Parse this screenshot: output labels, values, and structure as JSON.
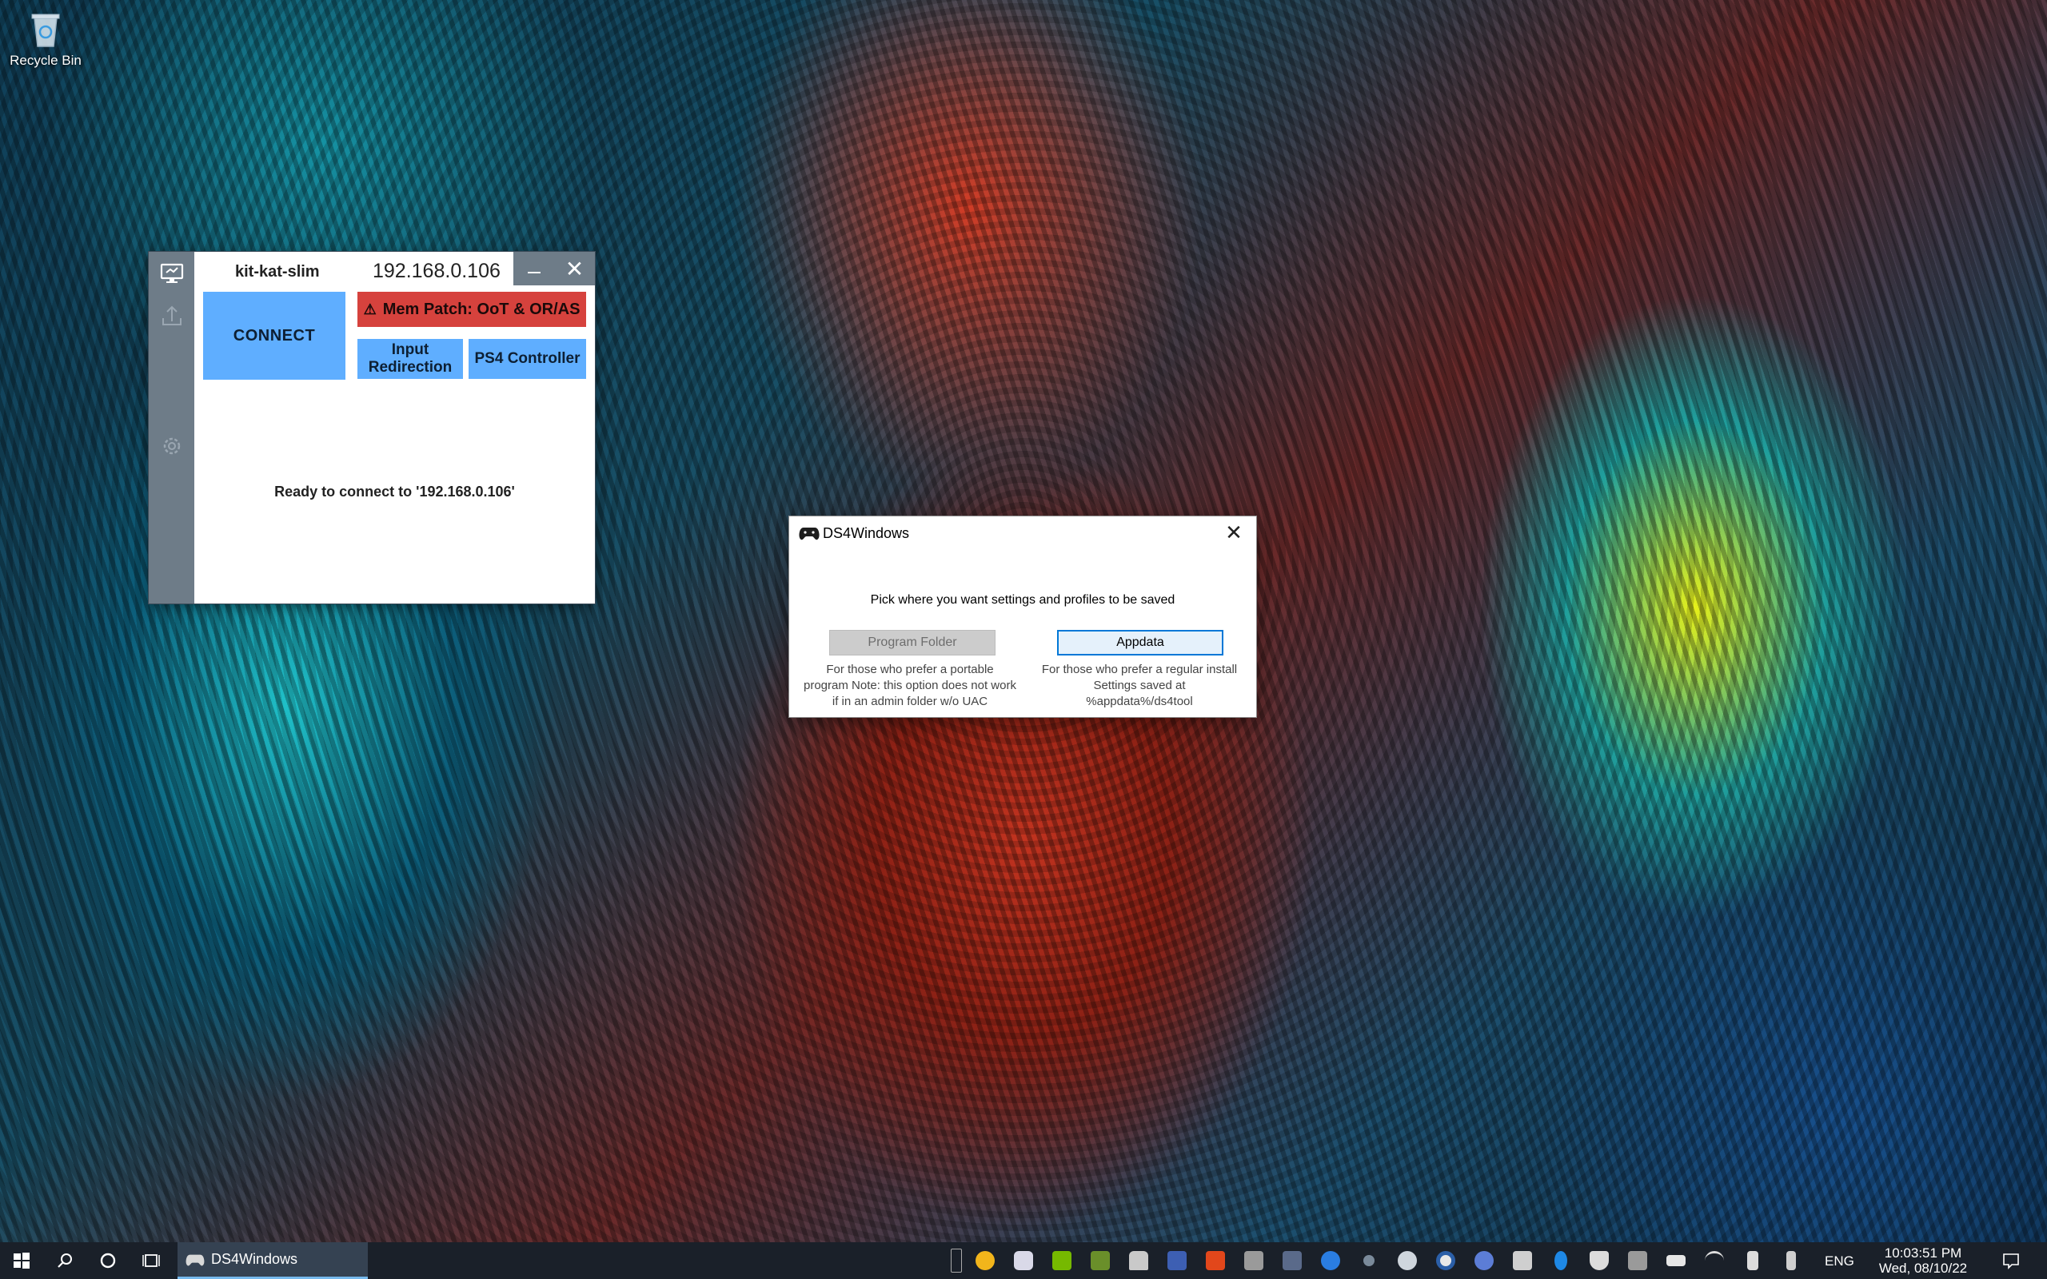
{
  "desktop": {
    "recycle_bin_label": "Recycle Bin"
  },
  "citra_window": {
    "hostname": "kit-kat-slim",
    "ip": "192.168.0.106",
    "connect_label": "CONNECT",
    "mem_patch_icon": "⚠",
    "mem_patch_label": "Mem Patch: OoT & OR/AS",
    "input_redirection_label_1": "Input",
    "input_redirection_label_2": "Redirection",
    "ps4_controller_label": "PS4 Controller",
    "status_text": "Ready to connect to '192.168.0.106'",
    "sidebar_icons": [
      "monitor-icon",
      "upload-icon",
      "gear-icon"
    ],
    "colors": {
      "accent_blue": "#5faeff",
      "warning_red": "#d6423d",
      "sidebar": "#6e7c88"
    }
  },
  "ds4_dialog": {
    "title": "DS4Windows",
    "prompt": "Pick where you want settings and profiles to be saved",
    "program_folder_label": "Program Folder",
    "appdata_label": "Appdata",
    "program_folder_desc_1": "For those who prefer a portable",
    "program_folder_desc_2": "program Note: this option does not work",
    "program_folder_desc_3": "if in an admin folder w/o UAC",
    "appdata_desc_1": "For those who prefer a regular install",
    "appdata_desc_2": "Settings saved at",
    "appdata_desc_3": "%appdata%/ds4tool"
  },
  "taskbar": {
    "app_label": "DS4Windows",
    "language": "ENG",
    "time": "10:03:51 PM",
    "date": "Wed, 08/10/22",
    "tray_icons": [
      "chevron-up-icon",
      "moon-icon",
      "discord-icon",
      "nvidia-icon",
      "excel-icon",
      "docker-icon",
      "font-icon",
      "app-icon",
      "drive-icon",
      "app-icon",
      "lightning-icon",
      "steam-icon",
      "steam-icon",
      "lifebuoy-icon",
      "qbittorrent-icon",
      "download-icon",
      "bluetooth-icon",
      "shield-icon",
      "app-icon",
      "battery-icon",
      "wifi-icon",
      "volume-icon",
      "usb-icon"
    ]
  }
}
